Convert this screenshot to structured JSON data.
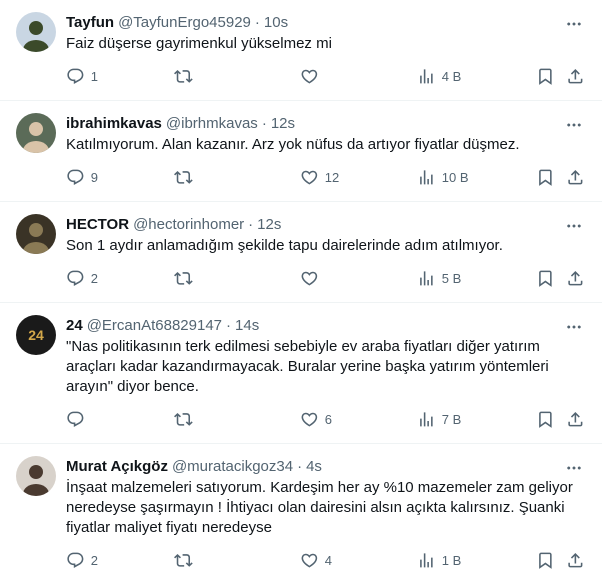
{
  "tweets": [
    {
      "name": "Tayfun",
      "handle": "@TayfunErgo45929",
      "time": "10s",
      "text": "Faiz düşerse gayrimenkul yükselmez mi",
      "replies": "1",
      "retweets": "",
      "likes": "",
      "views": "4 B",
      "avatar": {
        "bg": "#c9d6e3",
        "fg": "#3b4a2a"
      }
    },
    {
      "name": "ibrahimkavas",
      "handle": "@ibrhmkavas",
      "time": "12s",
      "text": "Katılmıyorum. Alan kazanır. Arz yok nüfus da artıyor fiyatlar düşmez.",
      "replies": "9",
      "retweets": "",
      "likes": "12",
      "views": "10 B",
      "avatar": {
        "bg": "#5b6b58",
        "fg": "#d9c3a8"
      }
    },
    {
      "name": "HECTOR",
      "handle": "@hectorinhomer",
      "time": "12s",
      "text": "Son 1 aydır anlamadığım şekilde tapu dairelerinde adım atılmıyor.",
      "replies": "2",
      "retweets": "",
      "likes": "",
      "views": "5 B",
      "avatar": {
        "bg": "#3a3326",
        "fg": "#8a7a55"
      }
    },
    {
      "name": "24",
      "handle": "@ErcanAt68829147",
      "time": "14s",
      "text": "\"Nas politikasının terk edilmesi sebebiyle ev araba fiyatları diğer yatırım araçları kadar kazandırmayacak. Buralar yerine başka yatırım yöntemleri arayın\" diyor bence.",
      "replies": "",
      "retweets": "",
      "likes": "6",
      "views": "7 B",
      "avatar": {
        "bg": "#1a1a1a",
        "fg": "#d4a84a",
        "label": "24"
      }
    },
    {
      "name": "Murat Açıkgöz",
      "handle": "@muratacikgoz34",
      "time": "4s",
      "text": "İnşaat malzemeleri satıyorum. Kardeşim her ay %10 mazemeler zam geliyor neredeyse şaşırmayın ! İhtiyacı olan dairesini alsın açıkta kalırsınız. Şuanki fiyatlar maliyet fiyatı neredeyse",
      "replies": "2",
      "retweets": "",
      "likes": "4",
      "views": "1 B",
      "avatar": {
        "bg": "#d8d2cb",
        "fg": "#4a3a30"
      }
    }
  ],
  "icons": {
    "reply": "reply-icon",
    "retweet": "retweet-icon",
    "like": "heart-icon",
    "views": "views-chart-icon",
    "bookmark": "bookmark-icon",
    "share": "share-icon",
    "more": "more-dots-icon"
  },
  "colors": {
    "text": "#0f1419",
    "muted": "#536471",
    "divider": "#eff3f4"
  }
}
